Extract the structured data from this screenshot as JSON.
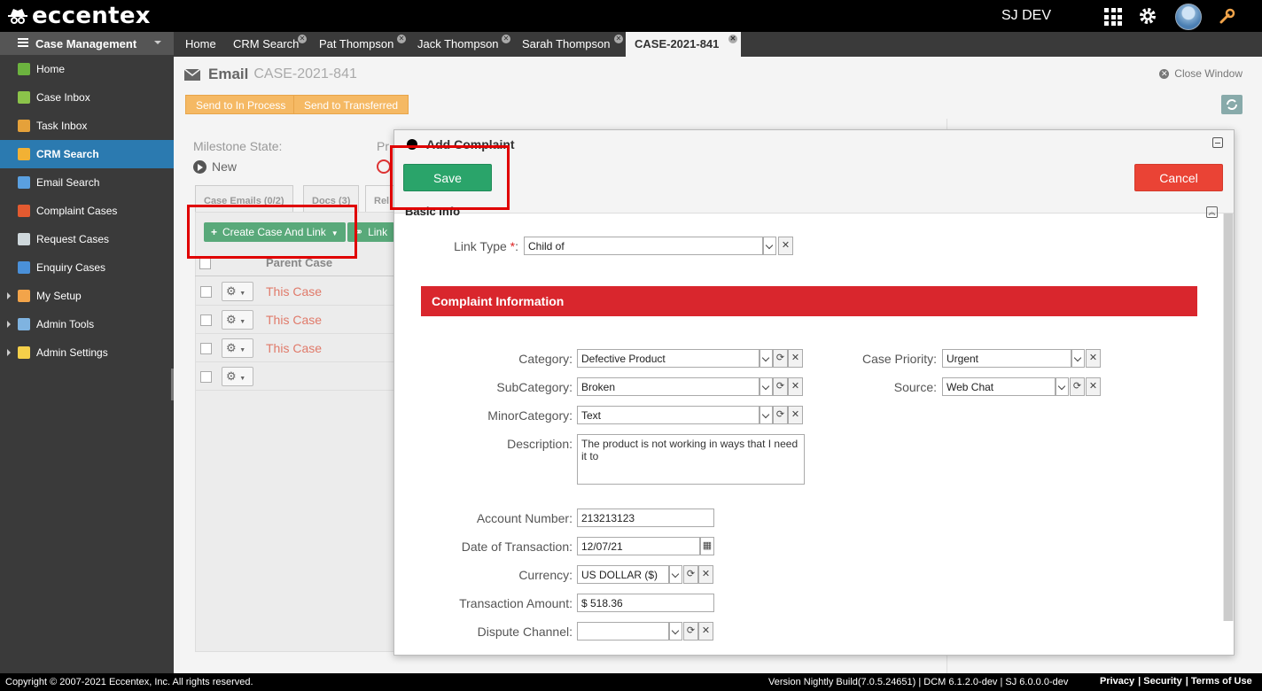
{
  "app": {
    "logo": "eccentex",
    "environment": "SJ DEV"
  },
  "sidebar": {
    "header": "Case Management",
    "items": [
      {
        "label": "Home",
        "icon": "pie-chart-icon",
        "color": "#6cb33f"
      },
      {
        "label": "Case Inbox",
        "icon": "inbox-icon",
        "color": "#8bc34a"
      },
      {
        "label": "Task Inbox",
        "icon": "clipboard-icon",
        "color": "#e5a13a"
      },
      {
        "label": "CRM Search",
        "icon": "users-icon",
        "color": "#f2b134",
        "active": true
      },
      {
        "label": "Email Search",
        "icon": "envelope-icon",
        "color": "#5aa0e0"
      },
      {
        "label": "Complaint Cases",
        "icon": "alert-icon",
        "color": "#e35a30"
      },
      {
        "label": "Request Cases",
        "icon": "megaphone-icon",
        "color": "#cfd8dc"
      },
      {
        "label": "Enquiry Cases",
        "icon": "info-icon",
        "color": "#4a90d9"
      },
      {
        "label": "My Setup",
        "icon": "wrench-icon",
        "color": "#f2a44a",
        "expandable": true
      },
      {
        "label": "Admin Tools",
        "icon": "tools-icon",
        "color": "#7fb3e0",
        "expandable": true
      },
      {
        "label": "Admin Settings",
        "icon": "folder-icon",
        "color": "#f5d04a",
        "expandable": true
      }
    ]
  },
  "tabs": [
    "Home",
    "CRM Search",
    "Pat Thompson",
    "Jack Thompson",
    "Sarah Thompson",
    "CASE-2021-841"
  ],
  "page": {
    "title": "Email",
    "case_id": "CASE-2021-841",
    "close_window": "Close Window",
    "btn_in_process": "Send to In Process",
    "btn_transferred": "Send to Transferred",
    "milestone_label": "Milestone State:",
    "milestone_value": "New",
    "pr_label": "Pr",
    "subtabs": [
      "Case Emails (0/2)",
      "Docs (3)",
      "Rel"
    ],
    "create_case_link": "Create Case And Link",
    "link_btn": "Link",
    "table_header": "Parent Case",
    "rows": [
      "This Case",
      "This Case",
      "This Case",
      ""
    ]
  },
  "modal": {
    "title": "Add Complaint",
    "save": "Save",
    "cancel": "Cancel",
    "section": "Basic Info",
    "link_type_label": "Link Type",
    "link_type_value": "Child of",
    "complaint_header": "Complaint Information",
    "fields": {
      "category_label": "Category:",
      "category_value": "Defective Product",
      "subcategory_label": "SubCategory:",
      "subcategory_value": "Broken",
      "minorcategory_label": "MinorCategory:",
      "minorcategory_value": "Text",
      "description_label": "Description:",
      "description_value": "The product is not working in ways that I need it to",
      "priority_label": "Case Priority:",
      "priority_value": "Urgent",
      "source_label": "Source:",
      "source_value": "Web Chat",
      "account_label": "Account Number:",
      "account_value": "213213123",
      "date_label": "Date of Transaction:",
      "date_value": "12/07/21",
      "currency_label": "Currency:",
      "currency_value": "US DOLLAR ($)",
      "amount_label": "Transaction Amount:",
      "amount_value": "$ 518.36",
      "dispute_label": "Dispute Channel:",
      "dispute_value": ""
    }
  },
  "footer": {
    "copyright": "Copyright © 2007-2021 Eccentex, Inc. All rights reserved.",
    "version": "Version   Nightly Build(7.0.5.24651) | DCM 6.1.2.0-dev | SJ 6.0.0.0-dev",
    "links": [
      "Privacy",
      "Security",
      "Terms of Use"
    ]
  },
  "colors": {
    "highlight": "#e00000",
    "save": "#2aa46a",
    "cancel": "#ea4335",
    "section_red": "#d9262d",
    "active_nav": "#2b7ab0"
  }
}
